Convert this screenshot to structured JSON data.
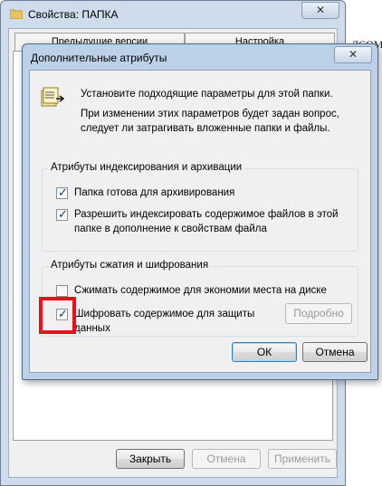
{
  "properties_window": {
    "title": "Свойства: ПАПКА",
    "close_glyph": "✕",
    "tabs": [
      "Предыдущие версии",
      "Настройка"
    ],
    "buttons": {
      "close": "Закрыть",
      "cancel": "Отмена",
      "apply": "Применить"
    }
  },
  "side_fragment": {
    "text": "ЛСОМ"
  },
  "dialog": {
    "title": "Дополнительные атрибуты",
    "close_glyph": "✕",
    "intro_line": "Установите подходящие параметры для этой папки.",
    "intro_note": "При изменении этих параметров будет задан вопрос, следует ли затрагивать вложенные папки и файлы.",
    "index_group": {
      "label": "Атрибуты индексирования и архивации",
      "archive": {
        "label": "Папка готова для архивирования",
        "checked": true
      },
      "index": {
        "label": "Разрешить индексировать содержимое файлов в этой папке в дополнение к свойствам файла",
        "checked": true
      }
    },
    "compress_group": {
      "label": "Атрибуты сжатия и шифрования",
      "compress": {
        "label": "Сжимать содержимое для экономии места на диске",
        "checked": false
      },
      "encrypt": {
        "label": "Шифровать содержимое для защиты данных",
        "checked": true
      },
      "details_button": "Подробно"
    },
    "ok_button": "ОК",
    "cancel_button": "Отмена"
  },
  "check_glyph": "✓",
  "colors": {
    "highlight": "#e3131b",
    "title_bar": "#bcd0e8",
    "dialog_face": "#f0f0f0"
  },
  "icons": {
    "title": "folder-icon",
    "dialog": "folder-attributes-icon"
  }
}
